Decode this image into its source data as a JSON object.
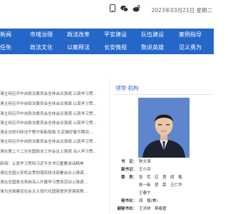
{
  "date": "2023年03月21日 星期二",
  "nav": {
    "row1": [
      "新闻",
      "市域治理",
      "政法改革",
      "平安建设",
      "队伍建设",
      "案例指导"
    ],
    "row2": [
      "任免",
      "政法文化",
      "以案释法",
      "长安微视",
      "数说英雄",
      "见义勇为"
    ]
  },
  "news": [
    "清主持召开中央政法委员会全体会议强调 认真学习贯…",
    "清主持召开中央政法委员会全体会议强调 认真学习贯…",
    "清主持召开中央政法委员会全体会议强调 认真学习贯…",
    "清主持召开中央政法委员会全体会议强调 认真学习贯…",
    "清走访慰问政法干警开拓新局面 扎实做好春节期间…",
    "清主持召开中央政法委员会全体会议强调 认真学习贯…",
    "清在第二十二次全国政法工作会议上强调 深入学习贯…",
    "新闻：认真学习贯彻习近平总书记重要讲话精神",
    "清在全国公安机关贯彻落实政法部署会议上强调…",
    "清在全国政法系统深入开展学习贯彻活动上强调…",
    "清为全面建设社会主义现代化国家提供坚强保障…"
  ],
  "panel": {
    "title": "领导·机构",
    "leaders": [
      {
        "role": "书　记：",
        "names": "陈文清"
      },
      {
        "role": "副书记：",
        "names": "王小洪"
      },
      {
        "role": "委　员：",
        "names": "张　军　应　勇　闻　楷"
      },
      {
        "role": "",
        "names": "陈一新　贺　荣　王仁华"
      },
      {
        "role": "",
        "names": "王春宁"
      },
      {
        "role": "秘书长：",
        "names": "闻　楷(兼)"
      },
      {
        "role": "副秘书长：",
        "names": "王洪祥　杨春雷"
      }
    ]
  }
}
